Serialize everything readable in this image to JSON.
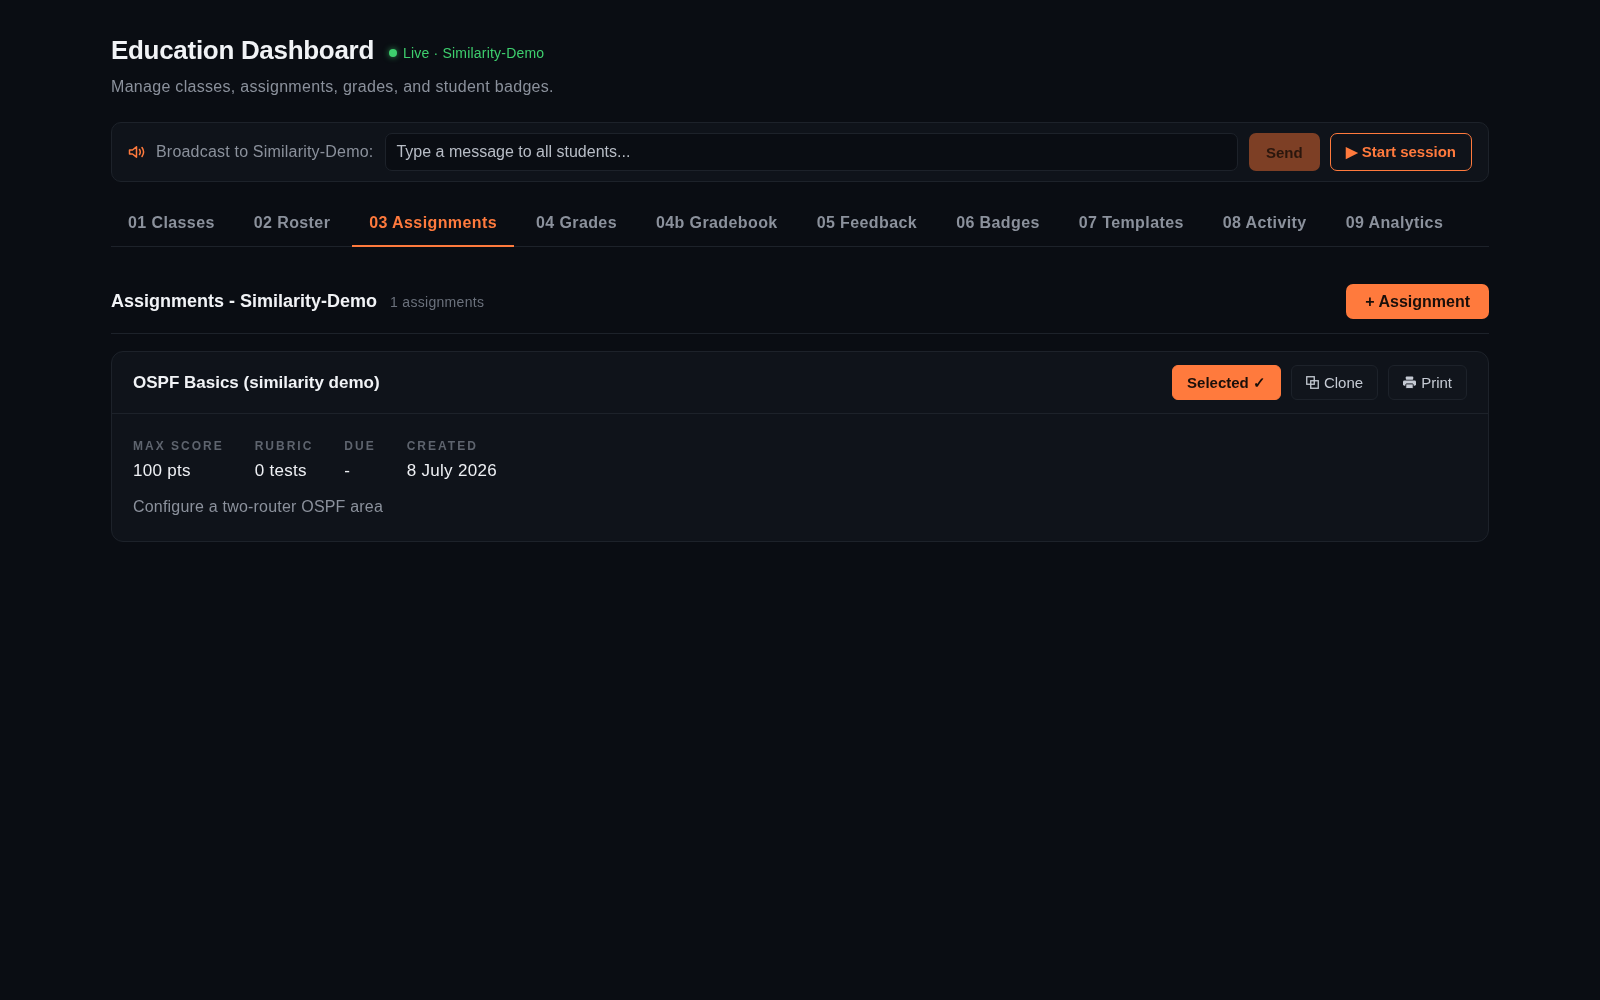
{
  "header": {
    "title": "Education Dashboard",
    "status": {
      "live": true,
      "label": "Live · Similarity-Demo"
    },
    "subtitle": "Manage classes, assignments, grades, and student badges."
  },
  "broadcast": {
    "label": "Broadcast to Similarity-Demo:",
    "placeholder": "Type a message to all students...",
    "send": {
      "label": "Send",
      "disabled": true
    },
    "start_session": {
      "label": "▶ Start session"
    }
  },
  "tabs": [
    {
      "label": "01 Classes",
      "selected": false
    },
    {
      "label": "02 Roster",
      "selected": false
    },
    {
      "label": "03 Assignments",
      "selected": true
    },
    {
      "label": "04 Grades",
      "selected": false
    },
    {
      "label": "04b Gradebook",
      "selected": false
    },
    {
      "label": "05 Feedback",
      "selected": false
    },
    {
      "label": "06 Badges",
      "selected": false
    },
    {
      "label": "07 Templates",
      "selected": false
    },
    {
      "label": "08 Activity",
      "selected": false
    },
    {
      "label": "09 Analytics",
      "selected": false
    }
  ],
  "section": {
    "title": "Assignments - Similarity-Demo",
    "count": "1 assignments",
    "add_button": "+ Assignment"
  },
  "assignments": [
    {
      "title": "OSPF Basics (similarity demo)",
      "selected": true,
      "select_label": "Selected ✓",
      "actions": [
        {
          "kind": "clone",
          "label": "Clone"
        },
        {
          "kind": "print",
          "label": "Print"
        }
      ],
      "fields": [
        {
          "label": "MAX SCORE",
          "value": "100 pts"
        },
        {
          "label": "RUBRIC",
          "value": "0 tests"
        },
        {
          "label": "DUE",
          "value": "-"
        },
        {
          "label": "CREATED",
          "value": "8 July 2026"
        }
      ],
      "description": "Configure a two-router OSPF area"
    }
  ]
}
